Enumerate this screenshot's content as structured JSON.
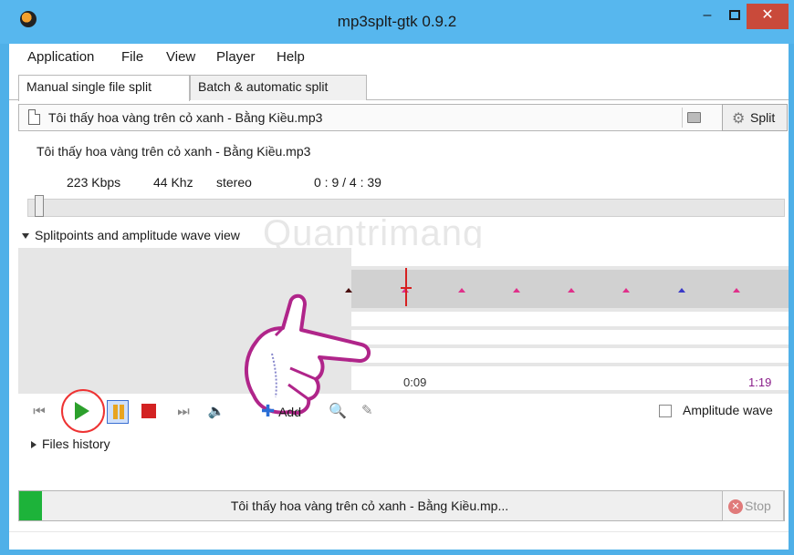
{
  "window": {
    "title": "mp3splt-gtk 0.9.2",
    "close_glyph": "✕",
    "min_glyph": "–"
  },
  "menu": [
    {
      "label": "Application"
    },
    {
      "label": "File"
    },
    {
      "label": "View"
    },
    {
      "label": "Player"
    },
    {
      "label": "Help"
    }
  ],
  "tabs": [
    {
      "label": "Manual single file split",
      "active": true
    },
    {
      "label": "Batch & automatic split",
      "active": false
    }
  ],
  "file_bar": {
    "filename": "Tôi thấy hoa vàng trên cỏ xanh - Bằng Kiều.mp3",
    "split_label": "Split"
  },
  "info": {
    "name": "Tôi thấy hoa vàng trên cỏ xanh - Bằng Kiều.mp3",
    "bitrate": "223 Kbps",
    "frequency": "44 Khz",
    "mode": "stereo",
    "time": "0 : 9 / 4 : 39"
  },
  "seek": {
    "position_fraction": 0.0
  },
  "wave": {
    "expander_label": "Splitpoints and amplitude wave view",
    "time_now": "0:09",
    "time_end": "1:19",
    "watermark": "Quantrimang"
  },
  "controls": {
    "add_label": "Add",
    "amplitude_label": "Amplitude wave",
    "amplitude_checked": false,
    "icons": [
      "skip-back-icon",
      "play-icon",
      "pause-icon",
      "stop-icon",
      "skip-forward-icon",
      "volume-icon",
      "add-icon",
      "zoom-icon",
      "edit-icon"
    ]
  },
  "files_history": {
    "label": "Files history"
  },
  "status": {
    "text": "Tôi thấy hoa vàng trên cỏ xanh - Bằng Kiều.mp...",
    "progress_fraction": 0.03,
    "stop_label": "Stop"
  },
  "colors": {
    "titlebar": "#57b7ee",
    "close": "#c94a3a",
    "progress": "#1db33a",
    "marker": "#e0308a",
    "cursor": "#d62020",
    "play": "#2ca02c",
    "end_time": "#8a1e8a"
  }
}
